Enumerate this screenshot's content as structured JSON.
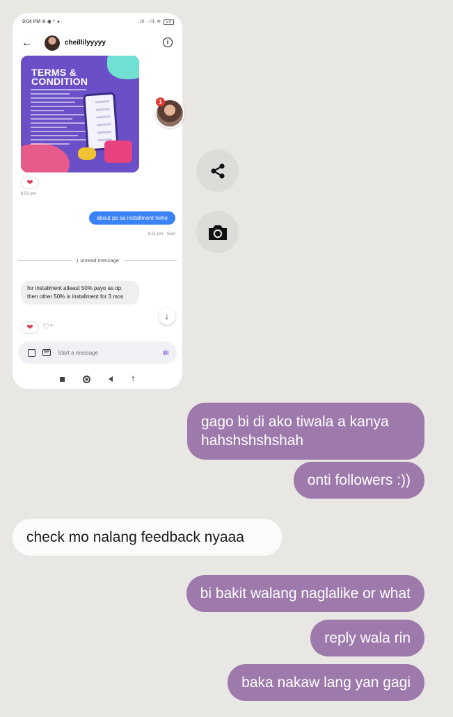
{
  "phone": {
    "status_bar": {
      "time": "9:04 PM",
      "icons_left": "⊚ ◉ ꙳ ◂ ·",
      "signal": ".ıll .ıll ≋",
      "battery": "59"
    },
    "chat_header": {
      "name": "cheillilyyyyy"
    },
    "poster": {
      "title_line1": "TERMS &",
      "title_line2": "CONDITION"
    },
    "message_time_1": "8:50 pm",
    "outgoing_message": "about po sa installment hehe",
    "outgoing_status": "8:51 pm · Sent",
    "unread_divider": "1 unread message",
    "incoming_message": "for installment atleast 50% payo as dp then other 50% is installment for 3 mos",
    "composer": {
      "placeholder": "Start a message"
    },
    "story_badge": "1"
  },
  "conversation": [
    {
      "direction": "out",
      "text": "gago bi di ako tiwala a kanya hahshshshshah"
    },
    {
      "direction": "out",
      "text": "onti followers :))"
    },
    {
      "direction": "in",
      "text": "check mo nalang feedback nyaaa"
    },
    {
      "direction": "out",
      "text": "bi bakit walang naglalike or what"
    },
    {
      "direction": "out",
      "text": "reply wala rin"
    },
    {
      "direction": "out",
      "text": "baka nakaw lang yan gagi"
    }
  ],
  "colors": {
    "background": "#e8e7e3",
    "outgoing_bubble": "#9e79ac",
    "incoming_bubble": "#fbfbfa",
    "phone_sent_bubble": "#3b82f6"
  },
  "icons": [
    "back-arrow-icon",
    "info-icon",
    "heart-icon",
    "add-reaction-icon",
    "arrow-down-icon",
    "gallery-icon",
    "gif-icon",
    "voice-icon",
    "share-icon",
    "camera-icon"
  ]
}
